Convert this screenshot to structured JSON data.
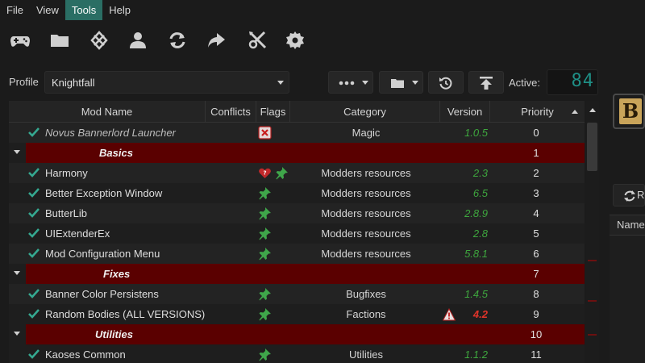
{
  "menu": {
    "file": "File",
    "view": "View",
    "tools": "Tools",
    "help": "Help"
  },
  "toolbar": {
    "icons": [
      "gamepad-icon",
      "folder-icon",
      "compass-icon",
      "user-icon",
      "refresh-icon",
      "share-icon",
      "tools-icon",
      "gear-icon"
    ]
  },
  "profile": {
    "label": "Profile",
    "value": "Knightfall"
  },
  "active": {
    "label": "Active:",
    "count": "84"
  },
  "table": {
    "headers": {
      "mod_name": "Mod Name",
      "conflicts": "Conflicts",
      "flags": "Flags",
      "category": "Category",
      "version": "Version",
      "priority": "Priority"
    },
    "rows": [
      {
        "type": "mod",
        "name": "Novus Bannerlord Launcher",
        "flag": "error",
        "category": "Magic",
        "version": "1.0.5",
        "priority": "0",
        "italic": true
      },
      {
        "type": "group",
        "name": "Basics",
        "priority": "1"
      },
      {
        "type": "mod",
        "name": "Harmony",
        "flag": "heart-pin",
        "category": "Modders resources",
        "version": "2.3",
        "priority": "2"
      },
      {
        "type": "mod",
        "name": "Better Exception Window",
        "flag": "pin",
        "category": "Modders resources",
        "version": "6.5",
        "priority": "3"
      },
      {
        "type": "mod",
        "name": "ButterLib",
        "flag": "pin",
        "category": "Modders resources",
        "version": "2.8.9",
        "priority": "4"
      },
      {
        "type": "mod",
        "name": "UIExtenderEx",
        "flag": "pin",
        "category": "Modders resources",
        "version": "2.8",
        "priority": "5"
      },
      {
        "type": "mod",
        "name": "Mod Configuration Menu",
        "flag": "pin",
        "category": "Modders resources",
        "version": "5.8.1",
        "priority": "6"
      },
      {
        "type": "group",
        "name": "Fixes",
        "priority": "7"
      },
      {
        "type": "mod",
        "name": "Banner Color Persistens",
        "flag": "pin",
        "category": "Bugfixes",
        "version": "1.4.5",
        "priority": "8"
      },
      {
        "type": "mod",
        "name": "Random Bodies (ALL VERSIONS)",
        "flag": "pin",
        "category": "Factions",
        "version": "4.2",
        "priority": "9",
        "warning": true
      },
      {
        "type": "group",
        "name": "Utilities",
        "priority": "10"
      },
      {
        "type": "mod",
        "name": "Kaoses Common",
        "flag": "pin",
        "category": "Utilities",
        "version": "1.1.2",
        "priority": "11"
      }
    ]
  },
  "right_panel": {
    "logo_letter": "B",
    "refresh_label": "Re",
    "name_header": "Name"
  },
  "colors": {
    "accent": "#2a6e64",
    "group_bg": "#5a0000",
    "version_ok": "#3ea63e",
    "version_bad": "#e0342a",
    "counter": "#1f8f86"
  }
}
